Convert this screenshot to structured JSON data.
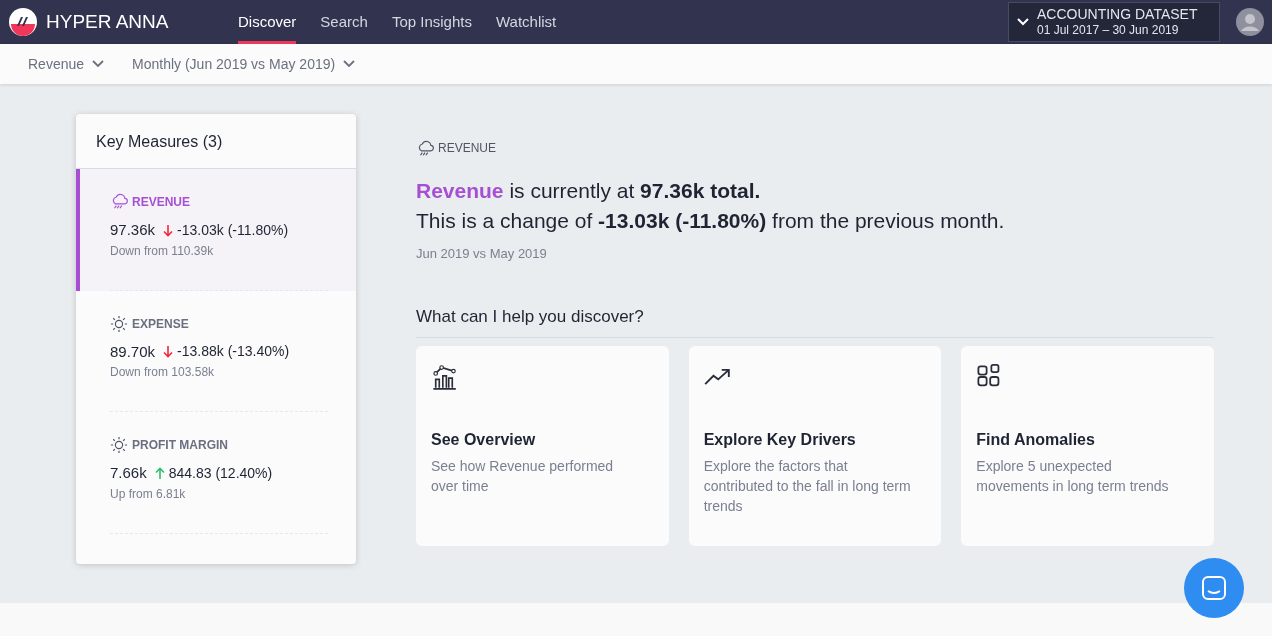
{
  "brand": {
    "name": "HYPER ANNA"
  },
  "tabs": [
    {
      "label": "Discover",
      "selected": true
    },
    {
      "label": "Search",
      "selected": false
    },
    {
      "label": "Top Insights",
      "selected": false
    },
    {
      "label": "Watchlist",
      "selected": false
    }
  ],
  "dataset": {
    "title": "ACCOUNTING DATASET",
    "range": "01 Jul 2017 – 30 Jun 2019"
  },
  "filters": [
    {
      "label": "Revenue"
    },
    {
      "label": "Monthly (Jun 2019 vs May 2019)"
    }
  ],
  "key_measures": {
    "title": "Key Measures (3)",
    "items": [
      {
        "kind": "rain",
        "name": "REVENUE",
        "value": "97.36k",
        "rising": false,
        "change": "-13.03k (-11.80%)",
        "note": "Down from 110.39k",
        "selected": true
      },
      {
        "kind": "sun",
        "name": "EXPENSE",
        "value": "89.70k",
        "rising": false,
        "change": "-13.88k (-13.40%)",
        "note": "Down from 103.58k",
        "selected": false
      },
      {
        "kind": "sun",
        "name": "PROFIT MARGIN",
        "value": "7.66k",
        "rising": true,
        "change": "844.83 (12.40%)",
        "note": "Up from 6.81k",
        "selected": false
      }
    ]
  },
  "insight": {
    "kind": "rain",
    "label": "REVENUE",
    "subject": "Revenue",
    "line_1": " is currently at **97.36k total.**",
    "line_2": "This is a change of **-13.03k (-11.80%)** from the previous month.",
    "period": "Jun 2019 vs May 2019"
  },
  "discover": {
    "heading": "What can I help you discover?",
    "cards": [
      {
        "kind": "chart",
        "title": "See Overview",
        "text": "See how Revenue performed over time"
      },
      {
        "kind": "trend",
        "title": "Explore Key Drivers",
        "text": "Explore the factors that contributed to the fall in long term trends"
      },
      {
        "kind": "grid",
        "title": "Find Anomalies",
        "text": "Explore 5 unexpected movements in long term trends"
      }
    ]
  }
}
